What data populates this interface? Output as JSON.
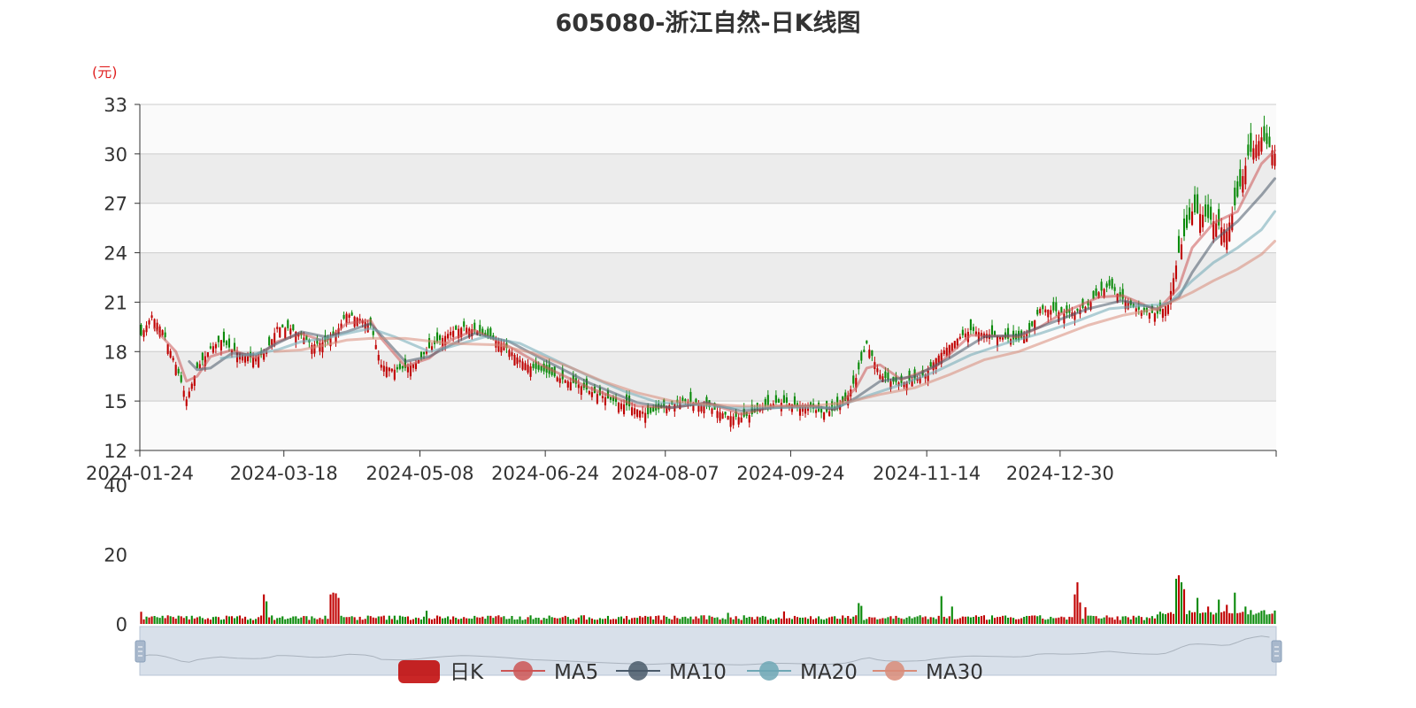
{
  "chart_data": {
    "type": "candlestick",
    "title": "605080-浙江自然-日K线图",
    "unit_label": "(元)",
    "price_axis": {
      "ylim": [
        12,
        33
      ],
      "ticks": [
        "33",
        "30",
        "27",
        "24",
        "21",
        "18",
        "15",
        "12"
      ]
    },
    "volume_axis": {
      "ylim": [
        0,
        40
      ],
      "ticks": [
        "40",
        "20",
        "0"
      ]
    },
    "x_ticks": [
      "2024-01-24",
      "2024-03-18",
      "2024-05-08",
      "2024-06-24",
      "2024-08-07",
      "2024-09-24",
      "2024-11-14",
      "2024-12-30"
    ],
    "legend": [
      "日K",
      "MA5",
      "MA10",
      "MA20",
      "MA30"
    ],
    "colors": {
      "up": "#c00000",
      "down": "#0a8a0a",
      "ma5": "#cc5555",
      "ma10": "#4a5a6a",
      "ma20": "#6fa7b5",
      "ma30": "#d98b78",
      "band_light": "#fafafa",
      "band_dark": "#ececec",
      "grid": "#cccccc",
      "slider_fill": "#d8e0ea"
    },
    "price_path": [
      [
        0,
        19.0
      ],
      [
        4,
        20.2
      ],
      [
        8,
        19.3
      ],
      [
        13,
        17.2
      ],
      [
        17,
        15.1
      ],
      [
        21,
        17.0
      ],
      [
        26,
        18.2
      ],
      [
        30,
        18.7
      ],
      [
        34,
        18.1
      ],
      [
        38,
        17.8
      ],
      [
        43,
        17.6
      ],
      [
        47,
        18.0
      ],
      [
        51,
        19.5
      ],
      [
        56,
        19.4
      ],
      [
        60,
        19.0
      ],
      [
        64,
        18.4
      ],
      [
        69,
        18.6
      ],
      [
        73,
        19.1
      ],
      [
        77,
        20.3
      ],
      [
        82,
        20.0
      ],
      [
        86,
        19.6
      ],
      [
        90,
        17.2
      ],
      [
        95,
        16.9
      ],
      [
        99,
        17.0
      ],
      [
        103,
        17.3
      ],
      [
        108,
        18.2
      ],
      [
        112,
        18.7
      ],
      [
        116,
        19.2
      ],
      [
        121,
        19.5
      ],
      [
        125,
        19.3
      ],
      [
        129,
        19.0
      ],
      [
        134,
        18.6
      ],
      [
        138,
        18.1
      ],
      [
        142,
        17.5
      ],
      [
        147,
        17.0
      ],
      [
        151,
        16.8
      ],
      [
        155,
        16.5
      ],
      [
        160,
        16.2
      ],
      [
        164,
        16.0
      ],
      [
        168,
        15.6
      ],
      [
        173,
        15.3
      ],
      [
        177,
        15.0
      ],
      [
        181,
        14.8
      ],
      [
        186,
        14.5
      ],
      [
        190,
        14.2
      ],
      [
        194,
        14.5
      ],
      [
        199,
        14.8
      ],
      [
        203,
        15.0
      ],
      [
        207,
        14.9
      ],
      [
        212,
        14.7
      ],
      [
        216,
        14.4
      ],
      [
        220,
        14.1
      ],
      [
        225,
        14.0
      ],
      [
        229,
        14.2
      ],
      [
        233,
        14.6
      ],
      [
        238,
        14.9
      ],
      [
        242,
        14.9
      ],
      [
        246,
        14.7
      ],
      [
        251,
        14.6
      ],
      [
        255,
        14.3
      ],
      [
        259,
        14.4
      ],
      [
        264,
        15.0
      ],
      [
        268,
        16.4
      ],
      [
        272,
        18.5
      ],
      [
        277,
        16.6
      ],
      [
        281,
        16.2
      ],
      [
        285,
        16.1
      ],
      [
        290,
        16.3
      ],
      [
        294,
        16.6
      ],
      [
        298,
        17.6
      ],
      [
        303,
        18.4
      ],
      [
        307,
        18.9
      ],
      [
        311,
        19.3
      ],
      [
        316,
        19.1
      ],
      [
        320,
        19.0
      ],
      [
        324,
        18.8
      ],
      [
        329,
        18.7
      ],
      [
        333,
        19.2
      ],
      [
        337,
        20.6
      ],
      [
        342,
        20.5
      ],
      [
        346,
        20.3
      ],
      [
        350,
        20.4
      ],
      [
        355,
        20.8
      ],
      [
        359,
        21.6
      ],
      [
        363,
        22.0
      ],
      [
        368,
        21.2
      ],
      [
        372,
        20.7
      ],
      [
        376,
        20.4
      ],
      [
        381,
        20.3
      ],
      [
        385,
        20.9
      ],
      [
        389,
        24.0
      ],
      [
        394,
        26.5
      ],
      [
        398,
        26.3
      ],
      [
        402,
        25.9
      ],
      [
        407,
        25.3
      ],
      [
        411,
        27.4
      ],
      [
        415,
        29.9
      ],
      [
        420,
        31.0
      ],
      [
        425,
        30.0
      ]
    ],
    "moving_averages": {
      "MA5": [
        [
          5,
          19.4
        ],
        [
          13,
          18.0
        ],
        [
          17,
          16.2
        ],
        [
          21,
          16.5
        ],
        [
          26,
          17.7
        ],
        [
          34,
          18.1
        ],
        [
          43,
          17.6
        ],
        [
          51,
          18.6
        ],
        [
          60,
          19.1
        ],
        [
          69,
          18.6
        ],
        [
          77,
          19.7
        ],
        [
          86,
          19.9
        ],
        [
          90,
          18.8
        ],
        [
          99,
          17.1
        ],
        [
          108,
          17.6
        ],
        [
          116,
          18.7
        ],
        [
          125,
          19.3
        ],
        [
          138,
          18.3
        ],
        [
          151,
          17.1
        ],
        [
          168,
          15.8
        ],
        [
          186,
          14.7
        ],
        [
          199,
          14.6
        ],
        [
          212,
          14.9
        ],
        [
          225,
          14.2
        ],
        [
          238,
          14.7
        ],
        [
          251,
          14.7
        ],
        [
          260,
          14.5
        ],
        [
          268,
          15.8
        ],
        [
          272,
          17.0
        ],
        [
          277,
          17.2
        ],
        [
          285,
          16.3
        ],
        [
          298,
          17.1
        ],
        [
          311,
          19.0
        ],
        [
          329,
          18.9
        ],
        [
          337,
          19.5
        ],
        [
          346,
          20.4
        ],
        [
          359,
          21.3
        ],
        [
          368,
          21.4
        ],
        [
          381,
          20.5
        ],
        [
          389,
          21.9
        ],
        [
          394,
          24.3
        ],
        [
          402,
          25.8
        ],
        [
          411,
          26.5
        ],
        [
          420,
          29.4
        ],
        [
          425,
          30.2
        ]
      ],
      "MA10": [
        [
          18,
          17.4
        ],
        [
          21,
          16.9
        ],
        [
          26,
          17.0
        ],
        [
          34,
          17.9
        ],
        [
          43,
          17.8
        ],
        [
          51,
          18.5
        ],
        [
          60,
          19.2
        ],
        [
          69,
          18.9
        ],
        [
          77,
          19.2
        ],
        [
          86,
          19.7
        ],
        [
          99,
          17.4
        ],
        [
          108,
          17.7
        ],
        [
          116,
          18.4
        ],
        [
          125,
          19.1
        ],
        [
          138,
          18.6
        ],
        [
          151,
          17.5
        ],
        [
          168,
          16.1
        ],
        [
          186,
          14.9
        ],
        [
          199,
          14.6
        ],
        [
          212,
          14.9
        ],
        [
          225,
          14.4
        ],
        [
          238,
          14.6
        ],
        [
          251,
          14.7
        ],
        [
          260,
          14.5
        ],
        [
          268,
          15.2
        ],
        [
          277,
          16.2
        ],
        [
          290,
          16.5
        ],
        [
          303,
          17.6
        ],
        [
          316,
          18.9
        ],
        [
          329,
          19.0
        ],
        [
          342,
          19.8
        ],
        [
          355,
          20.6
        ],
        [
          368,
          21.1
        ],
        [
          381,
          20.6
        ],
        [
          389,
          21.3
        ],
        [
          394,
          22.8
        ],
        [
          402,
          24.7
        ],
        [
          411,
          25.9
        ],
        [
          420,
          27.5
        ],
        [
          425,
          28.5
        ]
      ],
      "MA20": [
        [
          30,
          17.6
        ],
        [
          40,
          17.8
        ],
        [
          51,
          18.1
        ],
        [
          60,
          18.6
        ],
        [
          69,
          18.8
        ],
        [
          77,
          19.1
        ],
        [
          86,
          19.4
        ],
        [
          95,
          18.9
        ],
        [
          108,
          18.0
        ],
        [
          116,
          18.3
        ],
        [
          129,
          18.9
        ],
        [
          142,
          18.5
        ],
        [
          155,
          17.5
        ],
        [
          168,
          16.5
        ],
        [
          181,
          15.6
        ],
        [
          194,
          14.9
        ],
        [
          207,
          14.8
        ],
        [
          220,
          14.6
        ],
        [
          233,
          14.6
        ],
        [
          246,
          14.6
        ],
        [
          260,
          14.6
        ],
        [
          272,
          15.3
        ],
        [
          285,
          16.0
        ],
        [
          298,
          16.8
        ],
        [
          311,
          17.8
        ],
        [
          324,
          18.5
        ],
        [
          337,
          19.1
        ],
        [
          350,
          19.8
        ],
        [
          363,
          20.6
        ],
        [
          376,
          20.8
        ],
        [
          385,
          20.9
        ],
        [
          394,
          22.3
        ],
        [
          402,
          23.4
        ],
        [
          411,
          24.3
        ],
        [
          420,
          25.4
        ],
        [
          425,
          26.5
        ]
      ],
      "MA30": [
        [
          50,
          18.0
        ],
        [
          60,
          18.1
        ],
        [
          69,
          18.4
        ],
        [
          77,
          18.7
        ],
        [
          86,
          18.8
        ],
        [
          99,
          18.8
        ],
        [
          116,
          18.5
        ],
        [
          134,
          18.4
        ],
        [
          147,
          17.9
        ],
        [
          160,
          17.1
        ],
        [
          173,
          16.2
        ],
        [
          186,
          15.5
        ],
        [
          199,
          15.0
        ],
        [
          212,
          14.8
        ],
        [
          225,
          14.7
        ],
        [
          238,
          14.7
        ],
        [
          251,
          14.7
        ],
        [
          264,
          14.9
        ],
        [
          277,
          15.4
        ],
        [
          290,
          15.8
        ],
        [
          303,
          16.6
        ],
        [
          316,
          17.5
        ],
        [
          329,
          18.0
        ],
        [
          342,
          18.8
        ],
        [
          355,
          19.6
        ],
        [
          368,
          20.2
        ],
        [
          381,
          20.6
        ],
        [
          394,
          21.6
        ],
        [
          402,
          22.3
        ],
        [
          411,
          23.0
        ],
        [
          420,
          23.9
        ],
        [
          425,
          24.7
        ]
      ]
    },
    "volume_spikes": [
      [
        0,
        3.5
      ],
      [
        46,
        8.5
      ],
      [
        47,
        6.5
      ],
      [
        71,
        8.5
      ],
      [
        72,
        9.0
      ],
      [
        73,
        8.8
      ],
      [
        74,
        7.5
      ],
      [
        107,
        3.8
      ],
      [
        166,
        2.5
      ],
      [
        220,
        3.2
      ],
      [
        241,
        3.6
      ],
      [
        269,
        6.0
      ],
      [
        270,
        5.2
      ],
      [
        300,
        8.0
      ],
      [
        304,
        5.0
      ],
      [
        350,
        8.5
      ],
      [
        351,
        12.0
      ],
      [
        352,
        6.2
      ],
      [
        354,
        4.8
      ],
      [
        388,
        13.0
      ],
      [
        389,
        14.0
      ],
      [
        390,
        12.0
      ],
      [
        391,
        10.0
      ],
      [
        396,
        7.5
      ],
      [
        400,
        5.0
      ],
      [
        404,
        7.0
      ],
      [
        407,
        5.5
      ],
      [
        410,
        9.0
      ],
      [
        414,
        5.0
      ]
    ]
  },
  "legend_labels": {
    "dk": "日K",
    "ma5": "MA5",
    "ma10": "MA10",
    "ma20": "MA20",
    "ma30": "MA30"
  }
}
